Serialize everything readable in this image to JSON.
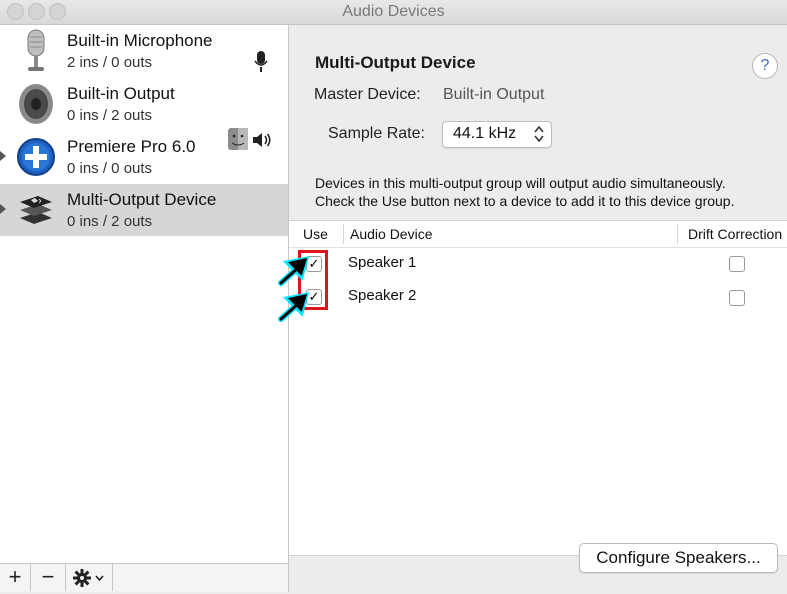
{
  "window": {
    "title": "Audio Devices"
  },
  "devices": [
    {
      "name": "Built-in Microphone",
      "io": "2 ins / 0 outs",
      "icon": "microphone-icon"
    },
    {
      "name": "Built-in Output",
      "io": "0 ins / 2 outs",
      "icon": "speaker-icon"
    },
    {
      "name": "Premiere Pro 6.0",
      "io": "0 ins / 0 outs",
      "icon": "plus-icon"
    },
    {
      "name": "Multi-Output Device",
      "io": "0 ins / 2 outs",
      "icon": "multi-output-icon",
      "selected": true
    }
  ],
  "toolbar": {
    "add": "+",
    "remove": "−"
  },
  "detail": {
    "heading": "Multi-Output Device",
    "help": "?",
    "master_label": "Master Device:",
    "master_value": "Built-in Output",
    "rate_label": "Sample Rate:",
    "rate_value": "44.1 kHz",
    "desc_line1": "Devices in this multi-output group will output audio simultaneously.",
    "desc_line2": "Check the Use button next to a device to add it to this device group."
  },
  "table": {
    "headers": {
      "use": "Use",
      "device": "Audio Device",
      "drift": "Drift Correction"
    },
    "rows": [
      {
        "device": "Speaker 1",
        "use": "✓",
        "use_checked": true,
        "drift_checked": false
      },
      {
        "device": "Speaker 2",
        "use": "✓",
        "use_checked": true,
        "drift_checked": false
      }
    ]
  },
  "configure_label": "Configure Speakers...",
  "colors": {
    "highlight": "#e0151b",
    "arrow_glow": "#00e5ff",
    "selection": "#d6d6d6"
  }
}
